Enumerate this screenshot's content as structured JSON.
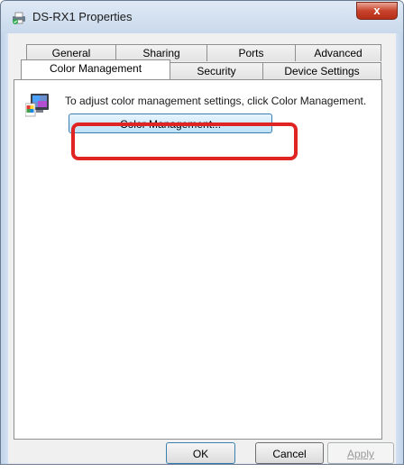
{
  "window": {
    "title": "DS-RX1 Properties",
    "close_label": "x"
  },
  "tabs": {
    "row1": [
      "General",
      "Sharing",
      "Ports",
      "Advanced"
    ],
    "row2": [
      "Color Management",
      "Security",
      "Device Settings"
    ],
    "active": "Color Management"
  },
  "panel": {
    "description": "To adjust color management settings, click Color Management.",
    "button_label": "Color Management..."
  },
  "footer": {
    "ok_label": "OK",
    "cancel_label": "Cancel",
    "apply_label": "Apply",
    "apply_enabled": false
  },
  "colors": {
    "highlight": "#e02424",
    "close_button": "#c7432c"
  }
}
